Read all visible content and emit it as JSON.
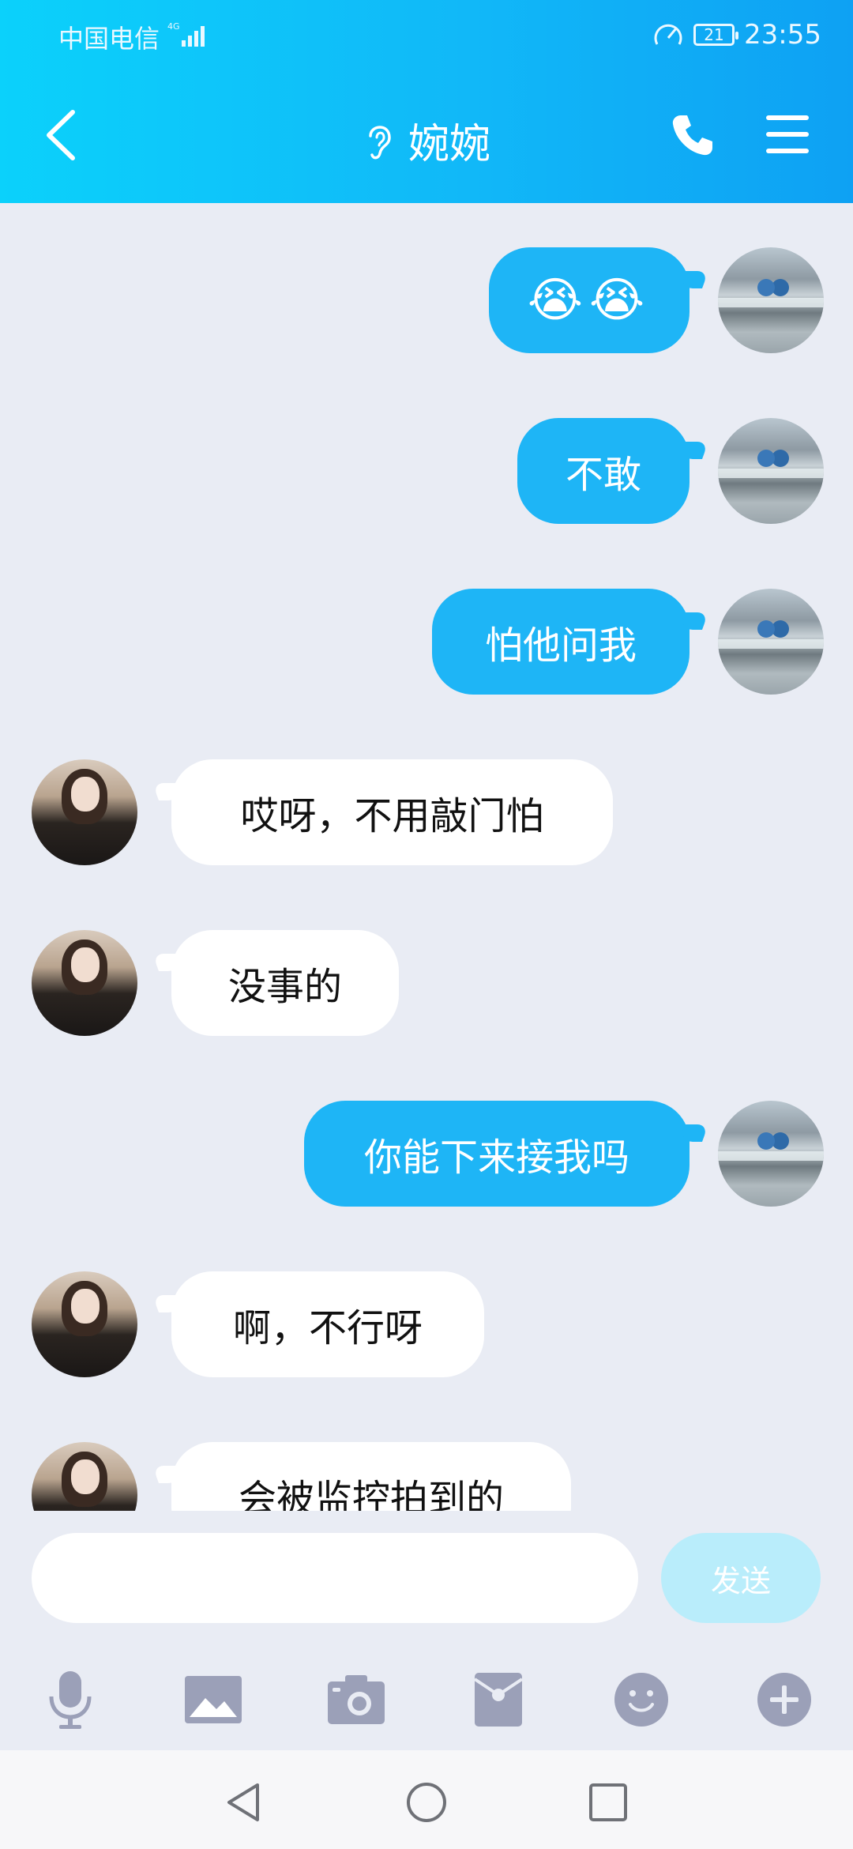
{
  "status_bar": {
    "carrier": "中国电信",
    "network": "4G",
    "battery": "21",
    "time": "23:55"
  },
  "header": {
    "title": "婉婉"
  },
  "messages": [
    {
      "from": "me",
      "text": "😭😭"
    },
    {
      "from": "me",
      "text": "不敢"
    },
    {
      "from": "me",
      "text": "怕他问我"
    },
    {
      "from": "her",
      "text": "哎呀，不用敲门怕"
    },
    {
      "from": "her",
      "text": "没事的"
    },
    {
      "from": "me",
      "text": "你能下来接我吗"
    },
    {
      "from": "her",
      "text": "啊，不行呀"
    },
    {
      "from": "her",
      "text": "会被监控拍到的"
    }
  ],
  "input": {
    "value": "",
    "send_label": "发送"
  },
  "toolbar": {
    "icons": [
      "microphone-icon",
      "image-icon",
      "camera-icon",
      "red-packet-icon",
      "emoji-icon",
      "plus-icon"
    ]
  },
  "navbar": {
    "icons": [
      "back-triangle-icon",
      "home-circle-icon",
      "recents-square-icon"
    ]
  },
  "colors": {
    "header_start": "#0bd1fb",
    "header_end": "#0ea1f3",
    "my_bubble": "#1eb5f6",
    "her_bubble": "#ffffff",
    "chat_bg": "#e9ecf4",
    "send_disabled": "#b9edfb",
    "icon_gray": "#9ba0b8"
  }
}
